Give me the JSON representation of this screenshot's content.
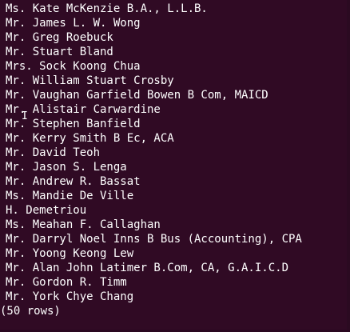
{
  "terminal": {
    "rows": [
      "Ms. Kate McKenzie B.A., L.L.B.",
      "Mr. James L. W. Wong",
      "Mr. Greg Roebuck",
      "Mr. Stuart Bland",
      "Mrs. Sock Koong Chua",
      "Mr. William Stuart Crosby",
      "Mr. Vaughan Garfield Bowen B Com, MAICD",
      "Mr. Alistair Carwardine",
      "Mr. Stephen Banfield",
      "Mr. Kerry Smith B Ec, ACA",
      "Mr. David Teoh",
      "Mr. Jason S. Lenga",
      "Mr. Andrew R. Bassat",
      "Ms. Mandie De Ville",
      "H. Demetriou",
      "Ms. Meahan F. Callaghan",
      "Mr. Darryl Noel Inns B Bus (Accounting), CPA",
      "Mr. Yoong Keong Lew",
      "Mr. Alan John Latimer B.Com, CA, G.A.I.C.D",
      "Mr. Gordon R. Timm",
      "Mr. York Chye Chang"
    ],
    "footer": "(50 rows)",
    "cursor_glyph": "I"
  },
  "colors": {
    "background": "#300a24",
    "text": "#ffffff"
  }
}
